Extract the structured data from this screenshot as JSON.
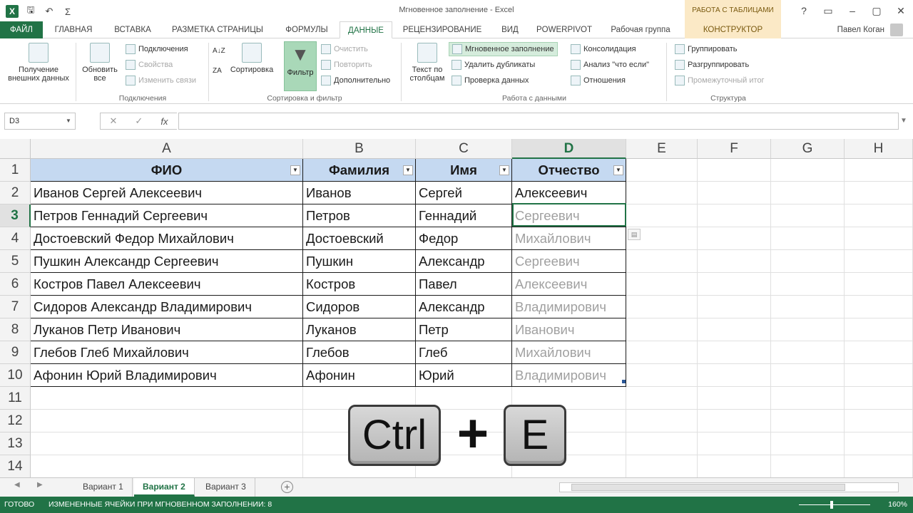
{
  "window": {
    "title": "Мгновенное заполнение - Excel",
    "context_header": "РАБОТА С ТАБЛИЦАМИ",
    "controls": [
      "?",
      "▭",
      "–",
      "▢",
      "✕"
    ]
  },
  "qat": {
    "logo": "X",
    "save": "🖫",
    "undo": "↶",
    "autosum": "Σ"
  },
  "tabs": [
    {
      "label": "ФАЙЛ"
    },
    {
      "label": "ГЛАВНАЯ"
    },
    {
      "label": "ВСТАВКА"
    },
    {
      "label": "РАЗМЕТКА СТРАНИЦЫ"
    },
    {
      "label": "ФОРМУЛЫ"
    },
    {
      "label": "ДАННЫЕ"
    },
    {
      "label": "РЕЦЕНЗИРОВАНИЕ"
    },
    {
      "label": "ВИД"
    },
    {
      "label": "POWERPIVOT"
    },
    {
      "label": "Рабочая группа"
    },
    {
      "label": "КОНСТРУКТОР"
    }
  ],
  "user": "Павел Коган",
  "ribbon": {
    "get_external_1": "Получение",
    "get_external_2": "внешних данных",
    "refresh_1": "Обновить",
    "refresh_2": "все",
    "connections": "Подключения",
    "properties": "Свойства",
    "edit_links": "Изменить связи",
    "group_connections": "Подключения",
    "sort": "Сортировка",
    "filter": "Фильтр",
    "clear": "Очистить",
    "reapply": "Повторить",
    "advanced": "Дополнительно",
    "group_sort": "Сортировка и фильтр",
    "text_to_cols_1": "Текст по",
    "text_to_cols_2": "столбцам",
    "flash_fill": "Мгновенное заполнение",
    "remove_dup": "Удалить дубликаты",
    "validation": "Проверка данных",
    "consolidate": "Консолидация",
    "whatif": "Анализ \"что если\"",
    "relations": "Отношения",
    "group_data": "Работа с данными",
    "group_btn": "Группировать",
    "ungroup_btn": "Разгруппировать",
    "subtotal": "Промежуточный итог",
    "group_outline": "Структура",
    "sort_az": "A↓Z",
    "sort_za": "ZA"
  },
  "formula_bar": {
    "name_box": "D3",
    "cancel": "✕",
    "enter": "✓",
    "fx": "fx",
    "value": ""
  },
  "columns": [
    "A",
    "B",
    "C",
    "D",
    "E",
    "F",
    "G",
    "H"
  ],
  "rows": [
    "1",
    "2",
    "3",
    "4",
    "5",
    "6",
    "7",
    "8",
    "9",
    "10",
    "11",
    "12",
    "13",
    "14"
  ],
  "table": {
    "headers": [
      "ФИО",
      "Фамилия",
      "Имя",
      "Отчество"
    ],
    "rows": [
      [
        "Иванов Сергей Алексеевич",
        "Иванов",
        "Сергей",
        "Алексеевич"
      ],
      [
        "Петров Геннадий Сергеевич",
        "Петров",
        "Геннадий",
        "Сергеевич"
      ],
      [
        "Достоевский Федор Михайлович",
        "Достоевский",
        "Федор",
        "Михайлович"
      ],
      [
        "Пушкин Александр Сергеевич",
        "Пушкин",
        "Александр",
        "Сергеевич"
      ],
      [
        "Костров Павел Алексеевич",
        "Костров",
        "Павел",
        "Алексеевич"
      ],
      [
        "Сидоров Александр Владимирович",
        "Сидоров",
        "Александр",
        "Владимирович"
      ],
      [
        "Луканов Петр Иванович",
        "Луканов",
        "Петр",
        "Иванович"
      ],
      [
        "Глебов Глеб Михайлович",
        "Глебов",
        "Глеб",
        "Михайлович"
      ],
      [
        "Афонин Юрий Владимирович",
        "Афонин",
        "Юрий",
        "Владимирович"
      ]
    ]
  },
  "overlay": {
    "key1": "Ctrl",
    "plus": "+",
    "key2": "E"
  },
  "sheets": [
    "Вариант 1",
    "Вариант 2",
    "Вариант 3"
  ],
  "active_sheet": "Вариант 2",
  "status": {
    "ready": "ГОТОВО",
    "message": "ИЗМЕНЕННЫЕ ЯЧЕЙКИ ПРИ МГНОВЕННОМ ЗАПОЛНЕНИИ: 8",
    "zoom": "160%"
  }
}
